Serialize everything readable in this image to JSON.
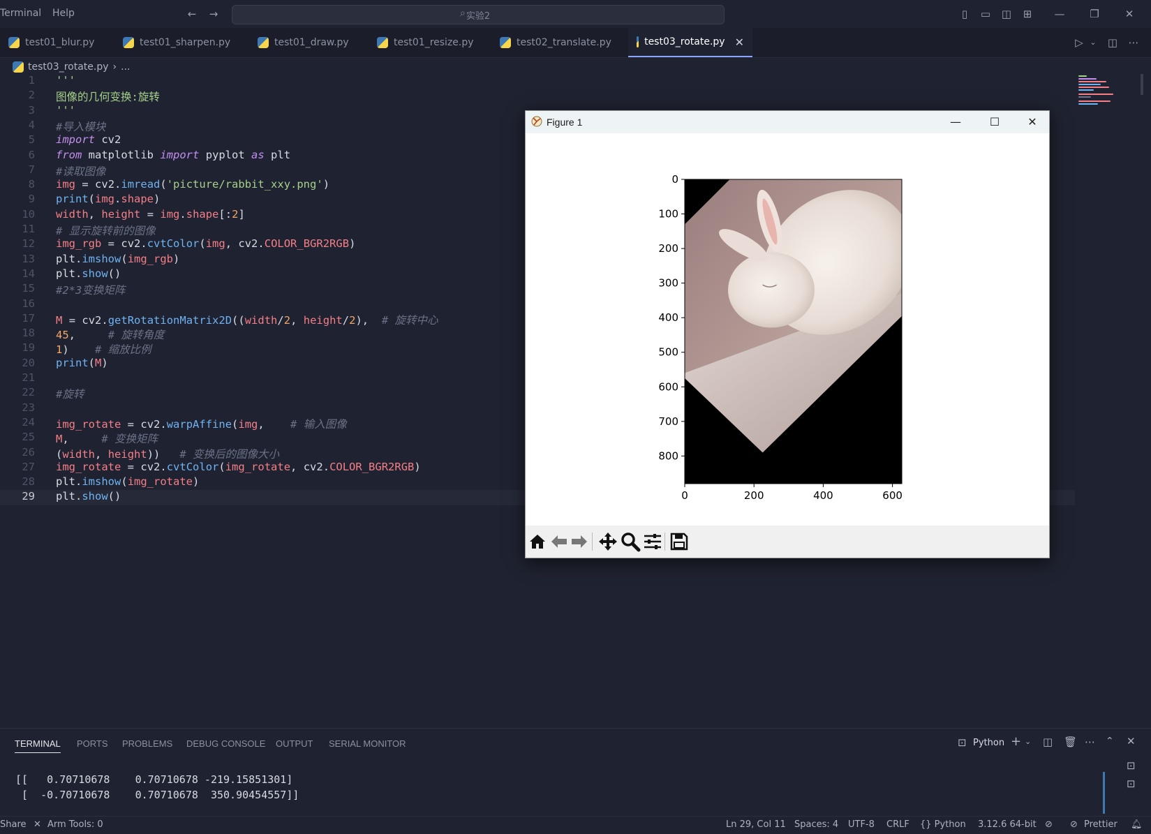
{
  "menu": {
    "terminal": "Terminal",
    "help": "Help"
  },
  "search": {
    "placeholder": "实验2"
  },
  "tabs": [
    {
      "label": "test01_blur.py"
    },
    {
      "label": "test01_sharpen.py"
    },
    {
      "label": "test01_draw.py"
    },
    {
      "label": "test01_resize.py"
    },
    {
      "label": "test02_translate.py"
    },
    {
      "label": "test03_rotate.py",
      "active": true
    }
  ],
  "breadcrumb": {
    "file": "test03_rotate.py",
    "more": "..."
  },
  "editor": {
    "current_line": 29,
    "lines": [
      "'''",
      "图像的几何变换:旋转",
      "'''",
      "#导入模块",
      "import cv2",
      "from matplotlib import pyplot as plt",
      "#读取图像",
      "img = cv2.imread('picture/rabbit_xxy.png')",
      "print(img.shape)",
      "width, height = img.shape[:2]",
      "# 显示旋转前的图像",
      "img_rgb = cv2.cvtColor(img, cv2.COLOR_BGR2RGB)",
      "plt.imshow(img_rgb)",
      "plt.show()",
      "#2*3变换矩阵",
      "",
      "M = cv2.getRotationMatrix2D((width/2, height/2),  # 旋转中心",
      "45,     # 旋转角度",
      "1)    # 缩放比例",
      "print(M)",
      "",
      "#旋转",
      "",
      "img_rotate = cv2.warpAffine(img,    # 输入图像",
      "M,     # 变换矩阵",
      "(width, height))   # 变换后的图像大小",
      "img_rotate = cv2.cvtColor(img_rotate, cv2.COLOR_BGR2RGB)",
      "plt.imshow(img_rotate)",
      "plt.show()"
    ]
  },
  "figure": {
    "title": "Figure 1",
    "minimize_glyph": "—",
    "maximize_glyph": "☐",
    "close_glyph": "✕"
  },
  "chart_data": {
    "type": "image",
    "xticks": [
      0,
      200,
      400,
      600
    ],
    "yticks": [
      0,
      100,
      200,
      300,
      400,
      500,
      600,
      700,
      800
    ],
    "xlim": [
      0,
      627
    ],
    "ylim": [
      880,
      0
    ]
  },
  "panel": {
    "tabs": [
      "TERMINAL",
      "PORTS",
      "PROBLEMS",
      "DEBUG CONSOLE",
      "OUTPUT",
      "SERIAL MONITOR"
    ],
    "shell_label": "Python",
    "terminal_lines": [
      "[[   0.70710678    0.70710678 -219.15851301]",
      " [  -0.70710678    0.70710678  350.90454557]]"
    ]
  },
  "statusbar": {
    "share": "Share",
    "arm_tools": "Arm Tools: 0",
    "position": "Ln 29, Col 11",
    "spaces": "Spaces: 4",
    "encoding": "UTF-8",
    "eol": "CRLF",
    "language": "{} Python",
    "interpreter": "3.12.6 64-bit",
    "prettier": "Prettier"
  },
  "colors": {
    "accent": "#8aa4ff",
    "background": "#1f2230"
  }
}
